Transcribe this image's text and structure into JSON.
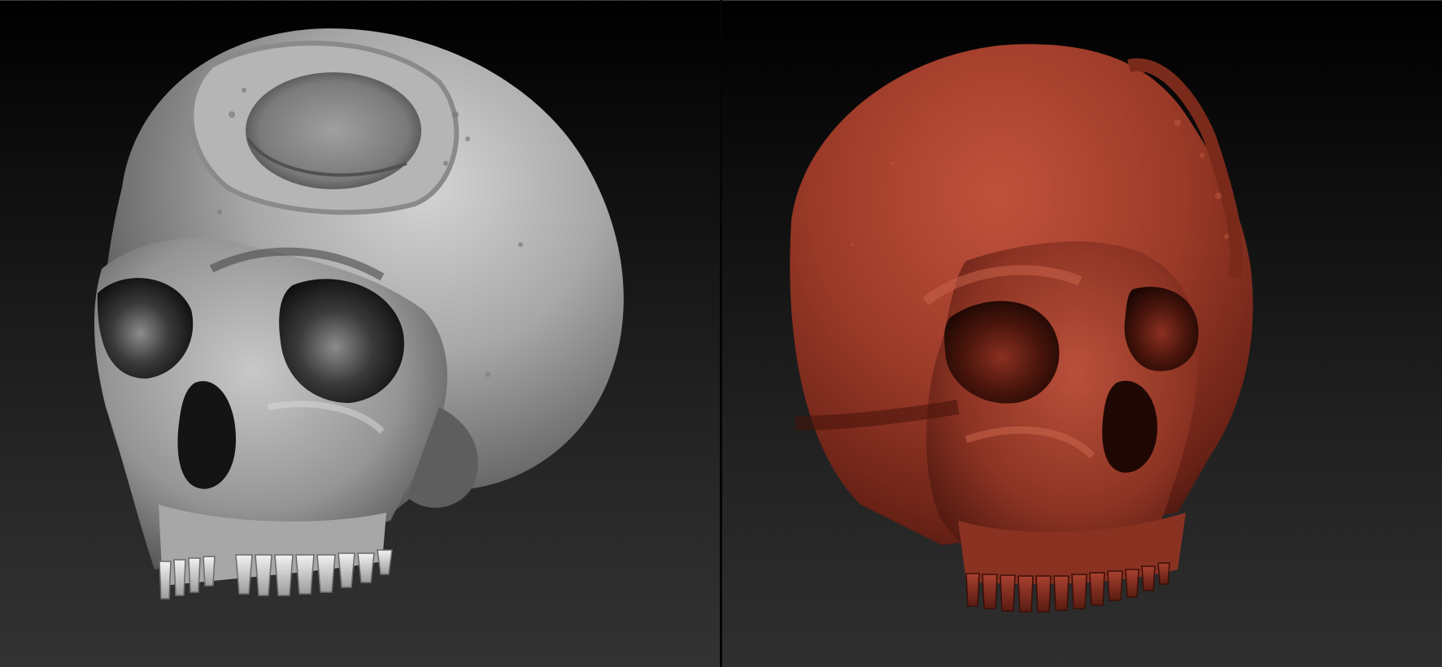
{
  "viewports": [
    {
      "id": "left",
      "material": "gray-matcap",
      "model": "skull"
    },
    {
      "id": "right",
      "material": "red-clay-matcap",
      "model": "skull"
    }
  ],
  "colors": {
    "background_top": "#000000",
    "background_bottom": "#333333",
    "gray_material": "#9a9a9a",
    "red_material": "#9a3a2a"
  }
}
